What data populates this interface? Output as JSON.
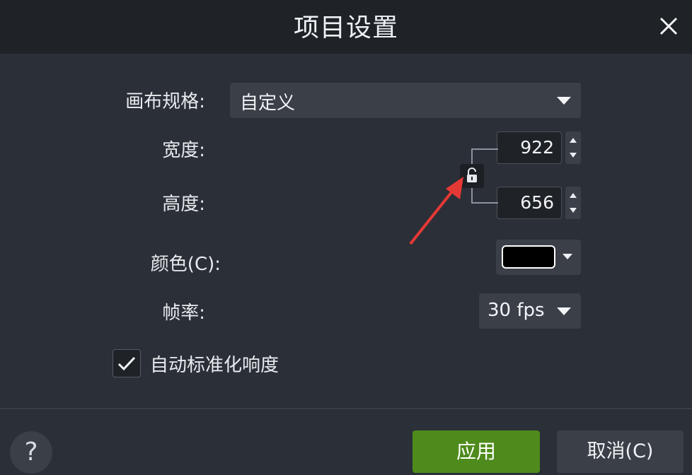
{
  "dialog": {
    "title": "项目设置",
    "close_icon": "close-icon"
  },
  "form": {
    "canvas_preset_label": "画布规格:",
    "canvas_preset_value": "自定义",
    "width_label": "宽度:",
    "width_value": "922",
    "height_label": "高度:",
    "height_value": "656",
    "lock_icon": "unlock-icon",
    "color_label": "颜色(C):",
    "color_value": "#000000",
    "frame_rate_label": "帧率:",
    "frame_rate_value": "30 fps",
    "auto_normalize_label": "自动标准化响度",
    "auto_normalize_checked": true
  },
  "footer": {
    "help_label": "?",
    "apply_label": "应用",
    "cancel_label": "取消(C)"
  },
  "annotation": {
    "arrow_color": "#e53935"
  },
  "colors": {
    "accent_apply": "#4e8b1c",
    "background": "#2b2f37",
    "titlebar": "#1f2227"
  }
}
